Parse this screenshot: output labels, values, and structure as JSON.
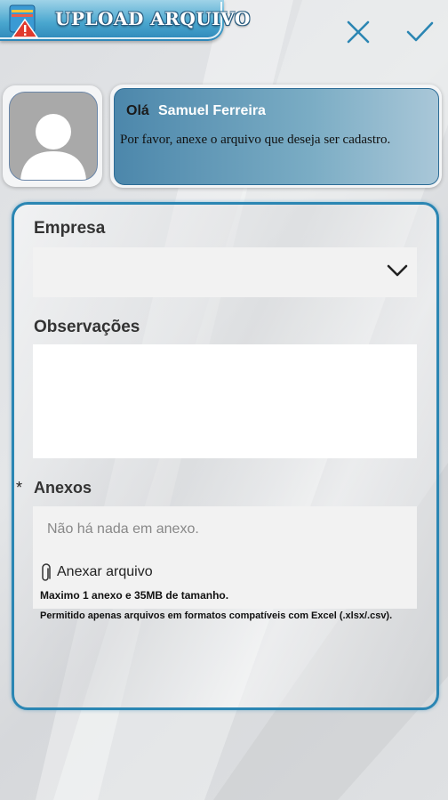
{
  "header": {
    "title": "UPLOAD ARQUIVO",
    "app_icon": "folder-warning-icon",
    "close_icon": "close-icon",
    "confirm_icon": "check-icon",
    "accent_color": "#2b86b3"
  },
  "greeting": {
    "hello": "Olá",
    "user_name": "Samuel Ferreira",
    "message": "Por favor, anexe o arquivo que deseja ser cadastro.",
    "avatar_icon": "user-avatar-icon"
  },
  "form": {
    "company_label": "Empresa",
    "company_value": "",
    "company_dropdown_icon": "chevron-down-icon",
    "notes_label": "Observações",
    "notes_value": "",
    "attachments_required_mark": "*",
    "attachments_label": "Anexos",
    "attachments_empty": "Não há nada em anexo.",
    "attach_button": "Anexar arquivo",
    "attach_icon": "paperclip-icon",
    "limit_text": "Maximo 1 anexo e 35MB de tamanho.",
    "allowed_text": "Permitido apenas arquivos em formatos compatíveis com Excel (.xlsx/.csv)."
  }
}
